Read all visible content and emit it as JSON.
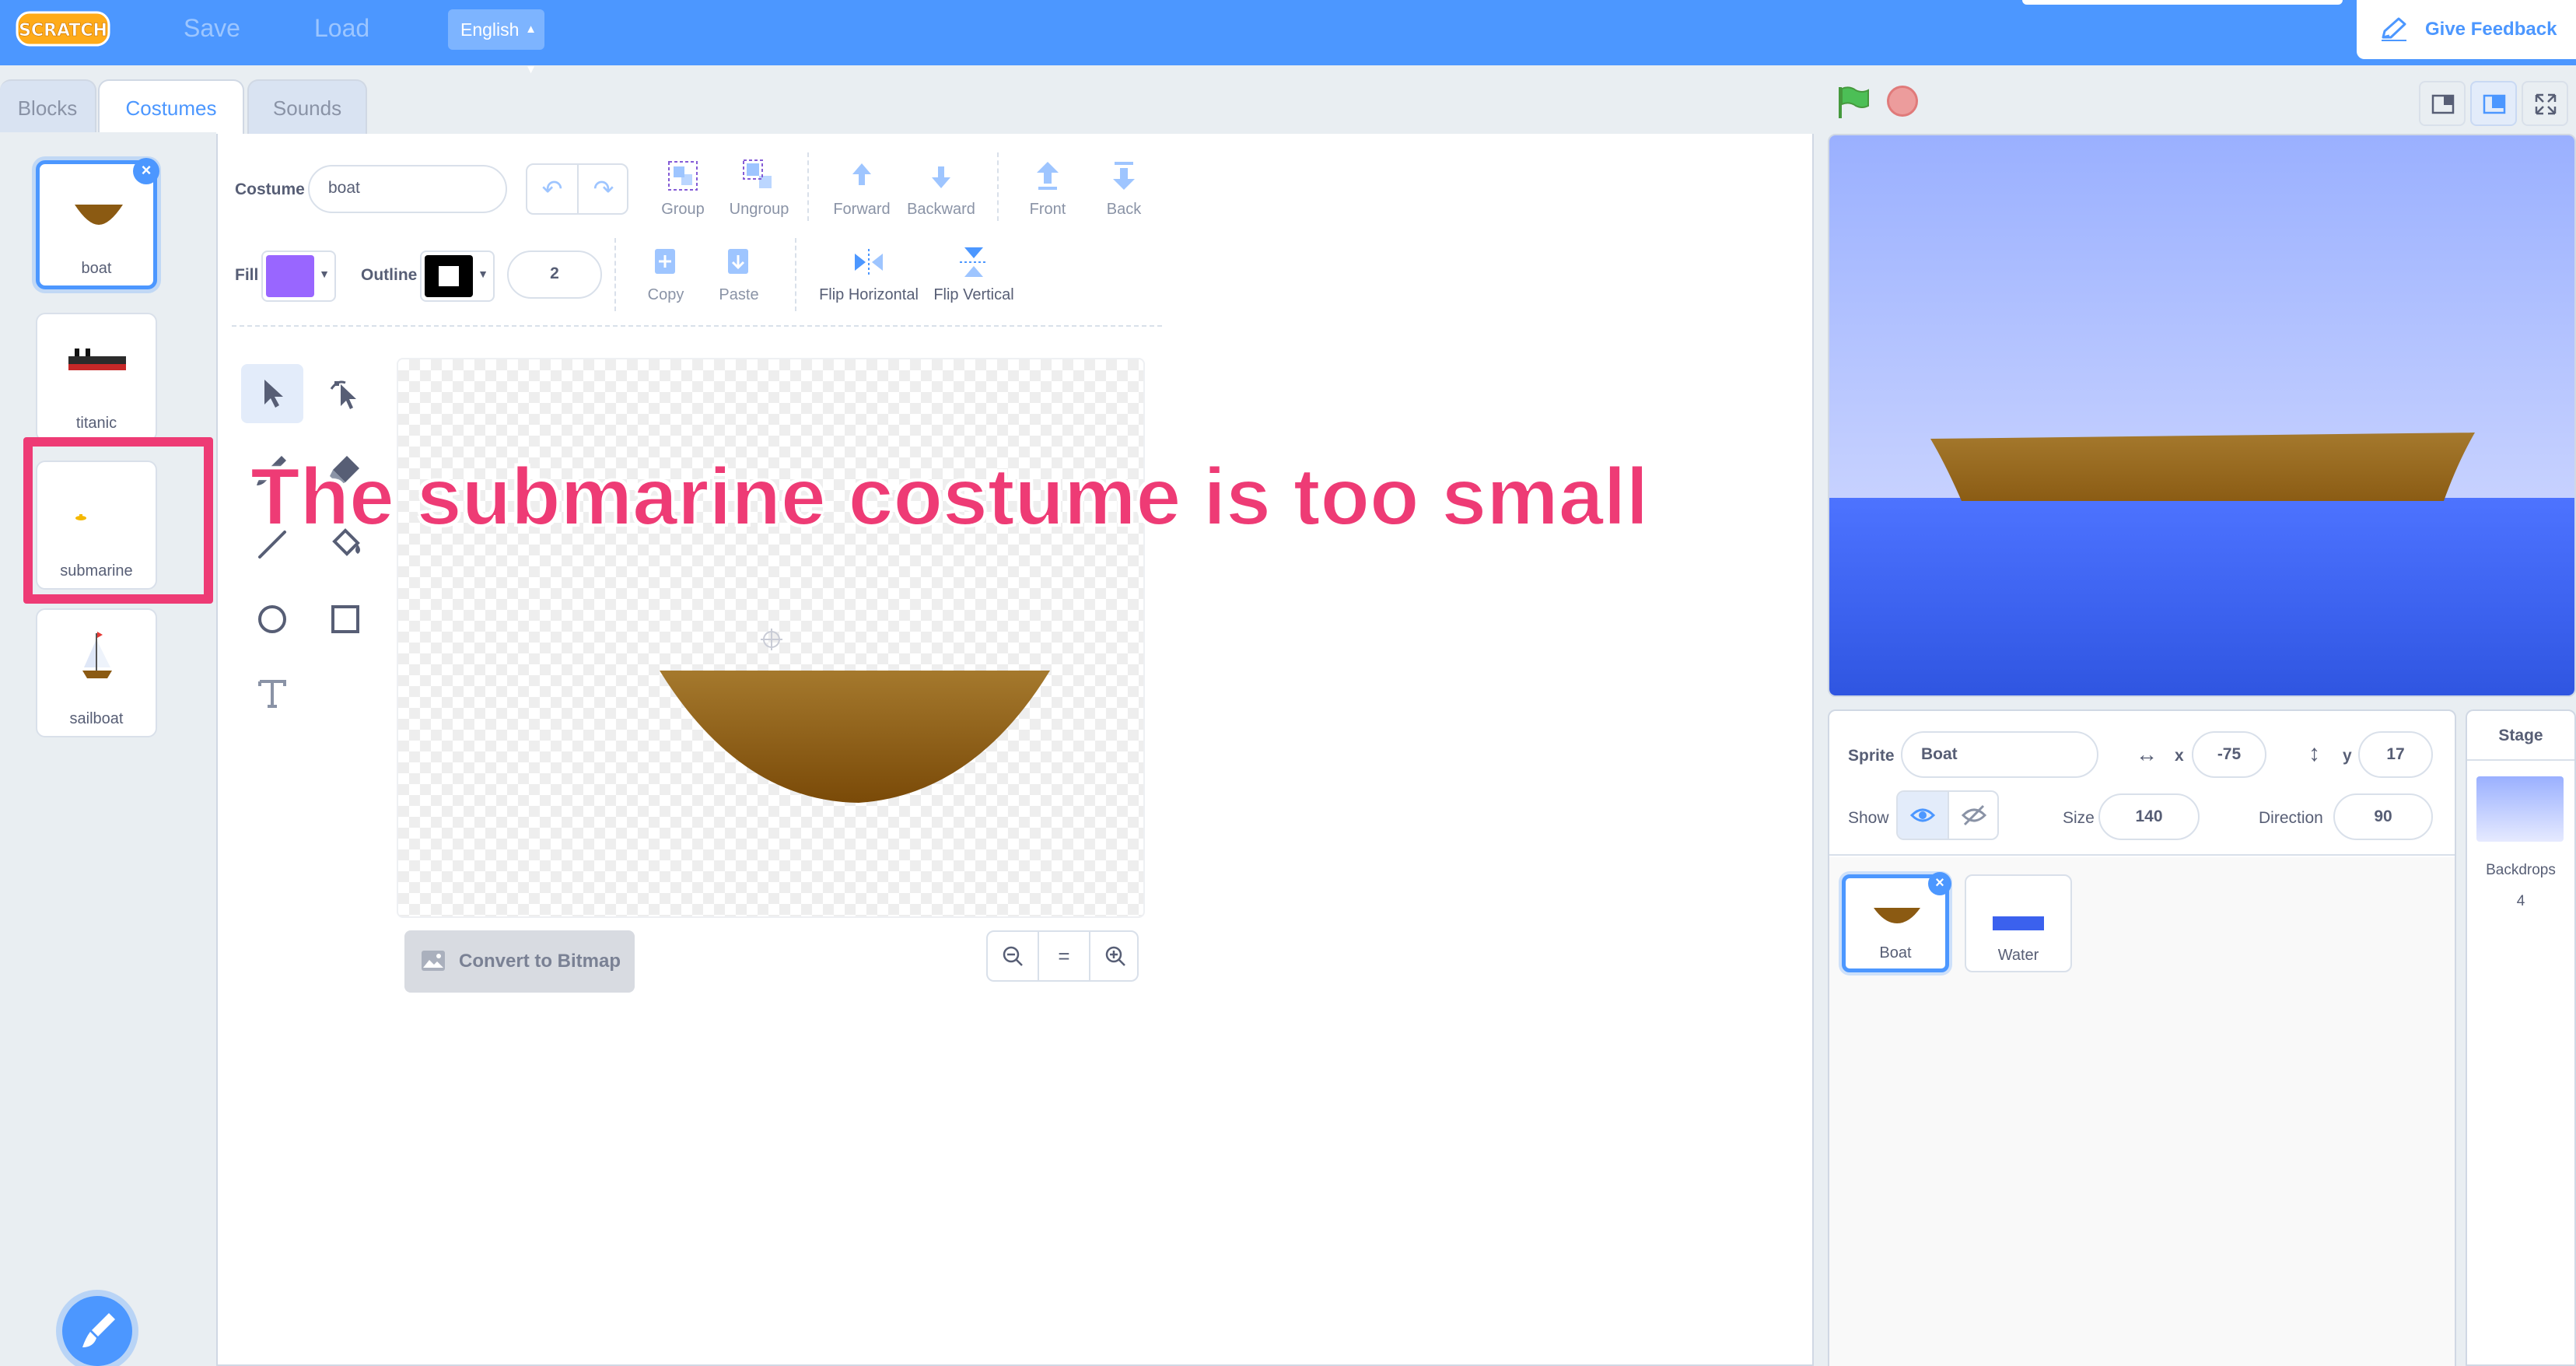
{
  "menubar": {
    "logo_text": "SCRATCH",
    "save": "Save",
    "load": "Load",
    "language": "English",
    "feedback": "Give Feedback"
  },
  "tabs": [
    {
      "label": "Blocks",
      "active": false
    },
    {
      "label": "Costumes",
      "active": true
    },
    {
      "label": "Sounds",
      "active": false
    }
  ],
  "costumes": [
    {
      "name": "boat",
      "selected": true
    },
    {
      "name": "titanic",
      "selected": false
    },
    {
      "name": "submarine",
      "selected": false
    },
    {
      "name": "sailboat",
      "selected": false
    }
  ],
  "paint": {
    "costume_label": "Costume",
    "costume_name": "boat",
    "fill_label": "Fill",
    "fill_color": "#9966ff",
    "outline_label": "Outline",
    "outline_color": "#000000",
    "outline_width": "2",
    "group": "Group",
    "ungroup": "Ungroup",
    "forward": "Forward",
    "backward": "Backward",
    "front": "Front",
    "back": "Back",
    "copy": "Copy",
    "paste": "Paste",
    "flip_h": "Flip Horizontal",
    "flip_v": "Flip Vertical",
    "convert": "Convert to Bitmap",
    "zoom_reset": "="
  },
  "annotation": "The submarine costume is too small",
  "sprite_info": {
    "sprite_label": "Sprite",
    "sprite_name": "Boat",
    "x_label": "x",
    "x": "-75",
    "y_label": "y",
    "y": "17",
    "show_label": "Show",
    "size_label": "Size",
    "size": "140",
    "direction_label": "Direction",
    "direction": "90"
  },
  "sprites": [
    {
      "name": "Boat",
      "selected": true
    },
    {
      "name": "Water",
      "selected": false
    }
  ],
  "stage_pane": {
    "title": "Stage",
    "backdrops_label": "Backdrops",
    "backdrops_count": "4"
  },
  "colors": {
    "menubar": "#4c97ff",
    "accent": "#4c97ff",
    "annotation": "#ee3b75",
    "boat_hull": "#8b5a12"
  }
}
